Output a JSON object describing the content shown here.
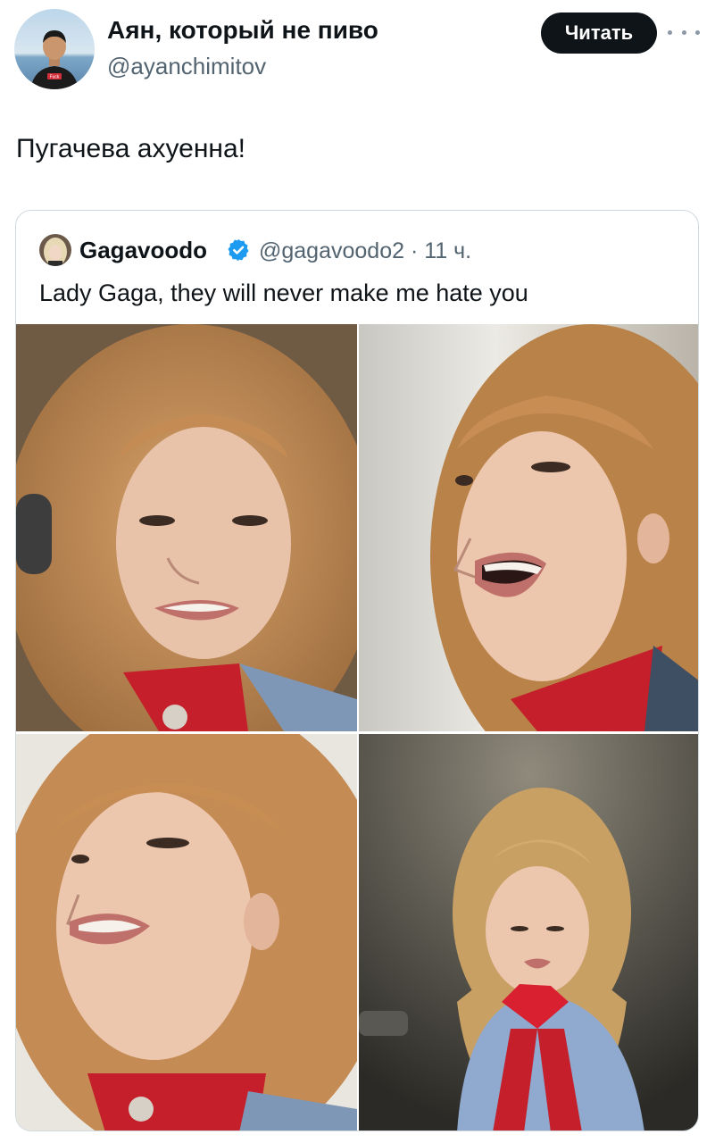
{
  "author": {
    "name": "Аян, который не пиво",
    "handle": "@ayanchimitov",
    "avatar_icon": "person-photo",
    "shirt_label": "Fuck"
  },
  "follow_label": "Читать",
  "tweet_text": "Пугачева ахуенна!",
  "quote": {
    "name": "Gagavoodo",
    "verified": true,
    "handle": "@gagavoodo2",
    "separator": "·",
    "time": "11 ч.",
    "text": "Lady Gaga, they will never make me hate you",
    "photos": [
      "photo-1",
      "photo-2",
      "photo-3",
      "photo-4"
    ]
  },
  "colors": {
    "follow_bg": "#0f1419",
    "secondary_text": "#536471",
    "verified_blue": "#1d9bf0",
    "border": "#cfd9de"
  }
}
